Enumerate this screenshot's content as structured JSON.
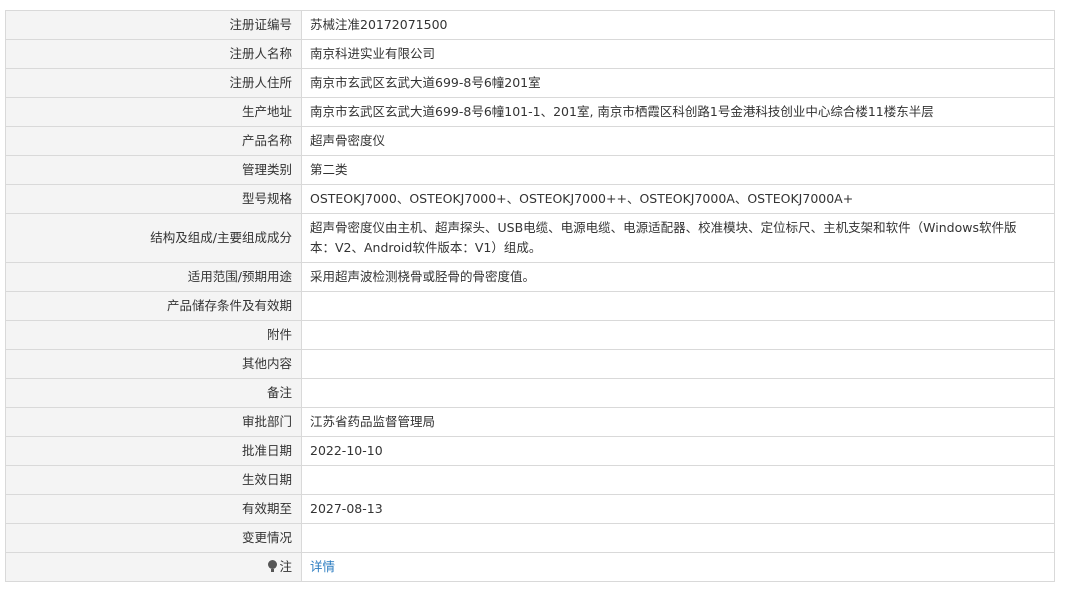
{
  "rows": [
    {
      "label": "注册证编号",
      "value": "苏械注准20172071500"
    },
    {
      "label": "注册人名称",
      "value": "南京科进实业有限公司"
    },
    {
      "label": "注册人住所",
      "value": "南京市玄武区玄武大道699-8号6幢201室"
    },
    {
      "label": "生产地址",
      "value": "南京市玄武区玄武大道699-8号6幢101-1、201室, 南京市栖霞区科创路1号金港科技创业中心综合楼11楼东半层"
    },
    {
      "label": "产品名称",
      "value": "超声骨密度仪"
    },
    {
      "label": "管理类别",
      "value": "第二类"
    },
    {
      "label": "型号规格",
      "value": "OSTEOKJ7000、OSTEOKJ7000+、OSTEOKJ7000++、OSTEOKJ7000A、OSTEOKJ7000A+"
    },
    {
      "label": "结构及组成/主要组成成分",
      "value": "超声骨密度仪由主机、超声探头、USB电缆、电源电缆、电源适配器、校准模块、定位标尺、主机支架和软件（Windows软件版本：V2、Android软件版本：V1）组成。"
    },
    {
      "label": "适用范围/预期用途",
      "value": "采用超声波检测桡骨或胫骨的骨密度值。"
    },
    {
      "label": "产品储存条件及有效期",
      "value": ""
    },
    {
      "label": "附件",
      "value": ""
    },
    {
      "label": "其他内容",
      "value": ""
    },
    {
      "label": "备注",
      "value": ""
    },
    {
      "label": "审批部门",
      "value": "江苏省药品监督管理局"
    },
    {
      "label": "批准日期",
      "value": "2022-10-10"
    },
    {
      "label": "生效日期",
      "value": ""
    },
    {
      "label": "有效期至",
      "value": "2027-08-13"
    },
    {
      "label": "变更情况",
      "value": ""
    }
  ],
  "note": {
    "label": "注",
    "icon": "lightbulb-icon",
    "link": "详情"
  }
}
